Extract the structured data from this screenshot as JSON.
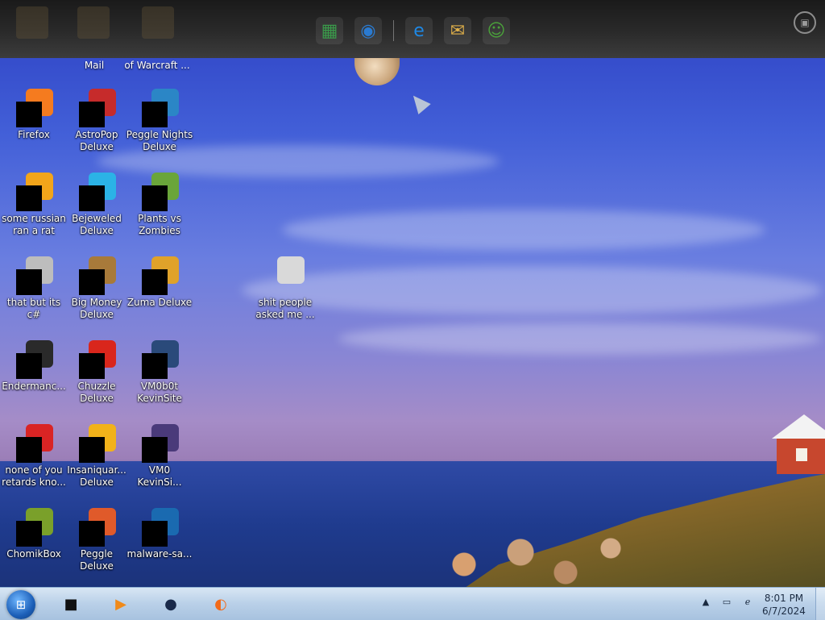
{
  "desktop": {
    "top_partial_labels": [
      {
        "text": "Mail"
      },
      {
        "text": "of Warcraft ..."
      }
    ],
    "icons": [
      {
        "id": "firefox",
        "label": "Firefox",
        "icon": "firefox-icon",
        "color": "#f57b1f"
      },
      {
        "id": "astropop",
        "label": "AstroPop\nDeluxe",
        "icon": "astropop-icon",
        "color": "#c62b2b"
      },
      {
        "id": "peggle-nights",
        "label": "Peggle Nights\nDeluxe",
        "icon": "peggle-nights-icon",
        "color": "#2b86c6"
      },
      {
        "id": "russian-rat",
        "label": "some russian\nran a rat",
        "icon": "document-icon",
        "color": "#f2a51a"
      },
      {
        "id": "bejeweled",
        "label": "Bejeweled\nDeluxe",
        "icon": "bejeweled-icon",
        "color": "#2bb3e6"
      },
      {
        "id": "pvz",
        "label": "Plants vs\nZombies",
        "icon": "plants-vs-zombies-icon",
        "color": "#6aa53a"
      },
      {
        "id": "csharp",
        "label": "that but its c#",
        "icon": "stacked-windows-icon",
        "color": "#bdbdbd"
      },
      {
        "id": "bigmoney",
        "label": "Big Money\nDeluxe",
        "icon": "money-bag-icon",
        "color": "#a87a3a"
      },
      {
        "id": "zuma",
        "label": "Zuma Deluxe",
        "icon": "zuma-icon",
        "color": "#e0a22a"
      },
      {
        "id": "enderman",
        "label": "Endermanc...",
        "icon": "app-window-icon",
        "color": "#2a2a2a"
      },
      {
        "id": "chuzzle",
        "label": "Chuzzle\nDeluxe",
        "icon": "chuzzle-icon",
        "color": "#d9261c"
      },
      {
        "id": "vm0b0t",
        "label": "VM0b0t\nKevinSite",
        "icon": "monitor-icon",
        "color": "#2a4a7a"
      },
      {
        "id": "none-of-you",
        "label": "none of you\nretards kno...",
        "icon": "opera-icon",
        "color": "#d92424"
      },
      {
        "id": "insaniquarium",
        "label": "Insaniquar...\nDeluxe",
        "icon": "fish-icon",
        "color": "#f2b21a"
      },
      {
        "id": "vm0",
        "label": "VM0\nKevinSi...",
        "icon": "book-icon",
        "color": "#4a3a7a"
      },
      {
        "id": "chomikbox",
        "label": "ChomikBox",
        "icon": "chomikbox-icon",
        "color": "#7aa02a"
      },
      {
        "id": "peggle",
        "label": "Peggle Deluxe",
        "icon": "peggle-icon",
        "color": "#e05a2a"
      },
      {
        "id": "malware",
        "label": "malware-sa...",
        "icon": "phone-icon",
        "color": "#1a6ab0"
      },
      {
        "id": "shit-people",
        "label": "shit people\nasked me ...",
        "icon": "folder-icon",
        "color": "#d9d9d9"
      }
    ]
  },
  "dock": {
    "items": [
      {
        "icon": "spreadsheet-cube-icon",
        "glyph": "▦",
        "color": "#3a9a4a"
      },
      {
        "icon": "globe-download-icon",
        "glyph": "◉",
        "color": "#2a7ad0"
      },
      {
        "icon": "internet-explorer-icon",
        "glyph": "e",
        "color": "#1e88e5"
      },
      {
        "icon": "mail-icon",
        "glyph": "✉",
        "color": "#e0b04a"
      },
      {
        "icon": "messenger-icon",
        "glyph": "☺",
        "color": "#4aa03a"
      }
    ],
    "settings_icon": "briefcase-icon"
  },
  "taskbar": {
    "apps": [
      {
        "icon": "black-box-icon",
        "glyph": "■",
        "color": "#111111"
      },
      {
        "icon": "media-player-icon",
        "glyph": "▶",
        "color": "#f08a1a"
      },
      {
        "icon": "dark-globe-icon",
        "glyph": "●",
        "color": "#1a2a4a"
      },
      {
        "icon": "firefox-icon",
        "glyph": "◐",
        "color": "#f26a1a"
      }
    ],
    "tray": {
      "chevron": "▲",
      "icons": [
        "network-icon",
        "internet-explorer-icon"
      ]
    },
    "clock": {
      "time": "8:01 PM",
      "date": "6/7/2024"
    }
  }
}
